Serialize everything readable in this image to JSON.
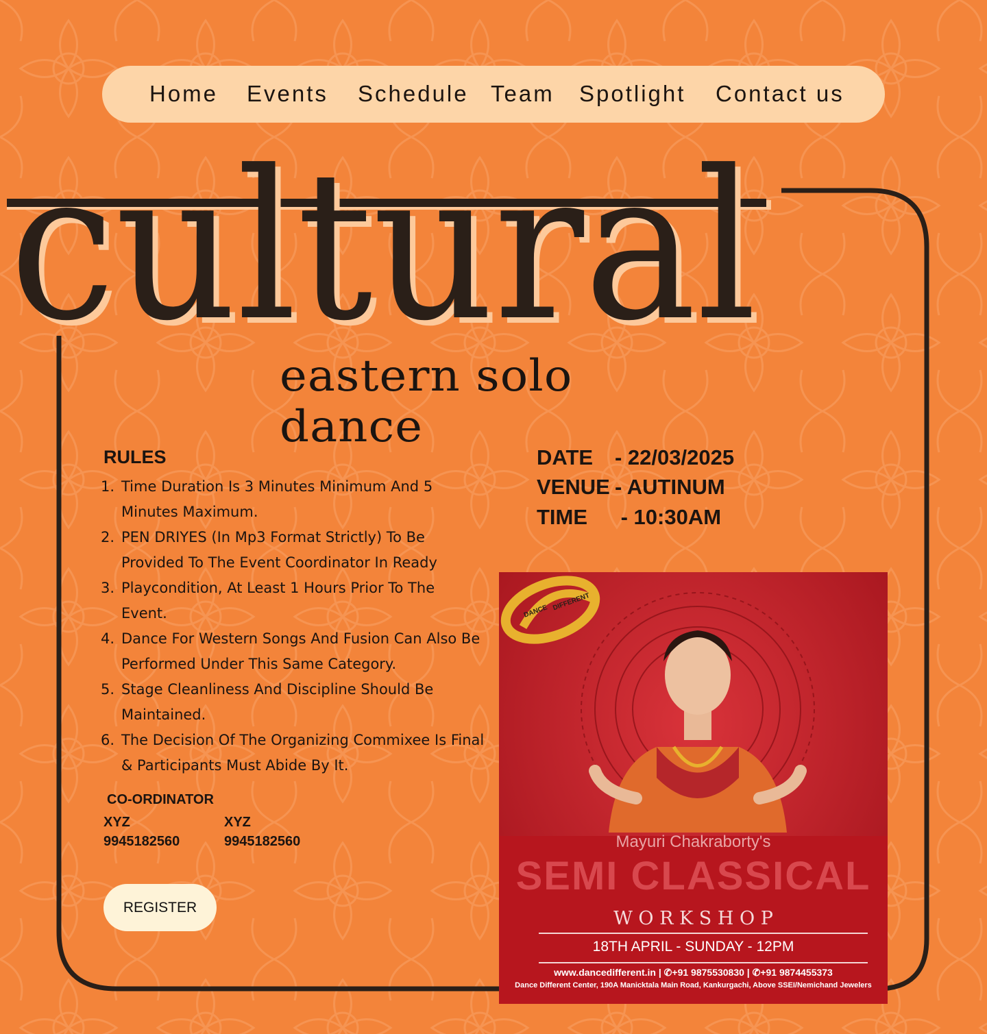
{
  "colors": {
    "background": "#F3843A",
    "nav_bg": "#FDD5A8",
    "dark": "#2A1F18",
    "accent_light": "#FDC99B",
    "button_bg": "#FEF3D8",
    "poster_red": "#C41E26",
    "logo_gold": "#E8B12E"
  },
  "nav": {
    "items": [
      "Home",
      "Events",
      "Schedule",
      "Team",
      "Spotlight",
      "Contact us"
    ]
  },
  "hero": {
    "title": "cultural"
  },
  "event": {
    "subtitle": "eastern solo dance"
  },
  "rules": {
    "title": "RULES",
    "items": [
      [
        "1.",
        "Time Duration Is 3 Minutes Minimum And 5",
        "Minutes Maximum."
      ],
      [
        "2.",
        "PEN DRIYES (In Mp3 Format Strictly) To Be",
        "Provided To The Event Coordinator In Ready"
      ],
      [
        "3.",
        "Playcondition, At Least 1 Hours Prior To The",
        "Event."
      ],
      [
        "4.",
        "Dance For Western Songs And Fusion Can Also Be",
        "Performed Under This Same Category."
      ],
      [
        "5.",
        "Stage Cleanliness And Discipline Should Be",
        "Maintained."
      ],
      [
        "6.",
        "The Decision Of The Organizing Commixee Is Final",
        "& Participants Must Abide By It."
      ]
    ]
  },
  "coordinators": {
    "title": "CO-ORDINATOR",
    "people": [
      {
        "name": "XYZ",
        "phone": "9945182560"
      },
      {
        "name": "XYZ",
        "phone": "9945182560"
      }
    ]
  },
  "register_label": "REGISTER",
  "details": [
    {
      "label": "DATE",
      "value": "-  22/03/2025"
    },
    {
      "label": "VENUE",
      "value": "- AUTINUM"
    },
    {
      "label": "TIME",
      "value": " - 10:30AM"
    }
  ],
  "poster": {
    "logo_words": [
      "DANCE",
      "DIFFERENT"
    ],
    "presenter": "Mayuri Chakraborty's",
    "headline": "SEMI CLASSICAL",
    "subhead": "W O R K S H O P",
    "date_line": "18TH APRIL - SUNDAY - 12PM",
    "contact_line": "www.dancedifferent.in  |  ✆+91 9875530830  |  ✆+91 9874455373",
    "address_line": "Dance Different Center, 190A Manicktala Main Road, Kankurgachi, Above SSEI/Nemichand Jewelers"
  }
}
